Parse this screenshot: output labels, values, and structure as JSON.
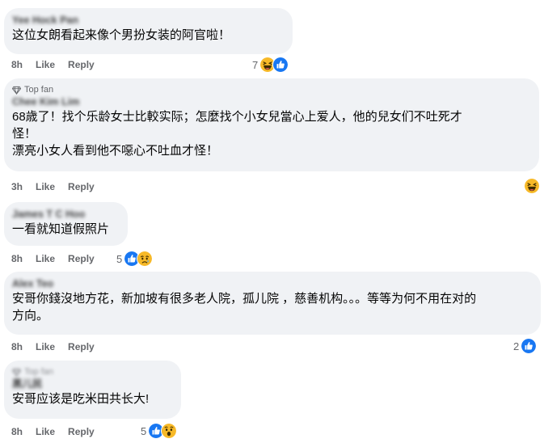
{
  "comments": [
    {
      "author": "Yee Hock Pan",
      "top_fan": false,
      "text": "这位女朗看起来像个男扮女装的阿官啦！",
      "time": "8h",
      "like": "Like",
      "reply": "Reply",
      "count": "7",
      "reactions": [
        "haha-icon",
        "like-icon"
      ]
    },
    {
      "author": "Chee Kim Lim",
      "top_fan": true,
      "top_fan_label": "Top fan",
      "text": "68歳了！找个乐龄女士比較实际；怎麼找个小女兒當心上爱人，他的兒女们不吐死才\n怪！\n漂亮小女人看到他不噁心不吐血才怪！",
      "time": "3h",
      "like": "Like",
      "reply": "Reply",
      "count": "",
      "reactions": [
        "haha-icon"
      ]
    },
    {
      "author": "James T C Hoo",
      "top_fan": false,
      "text": "一看就知道假照片",
      "time": "8h",
      "like": "Like",
      "reply": "Reply",
      "count": "5",
      "reactions": [
        "like-icon",
        "sad-icon"
      ]
    },
    {
      "author": "Alex Teo",
      "top_fan": false,
      "text": "安哥你錢沒地方花，新加坡有很多老人院，孤儿院 ，慈善机构。。。等等为何不用在对的\n方向。",
      "time": "8h",
      "like": "Like",
      "reply": "Reply",
      "count": "2",
      "reactions": [
        "like-icon"
      ]
    },
    {
      "author": "黑儿民",
      "top_fan": true,
      "top_fan_label": "Top fan",
      "text": "安哥应该是吃米田共长大!",
      "time": "8h",
      "like": "Like",
      "reply": "Reply",
      "count": "5",
      "reactions": [
        "like-icon",
        "wow-icon"
      ]
    }
  ],
  "colors": {
    "bubble": "#f0f2f5",
    "meta_text": "#65676b",
    "like_blue": "#1877f2",
    "emoji_yellow": "#f7b928"
  }
}
